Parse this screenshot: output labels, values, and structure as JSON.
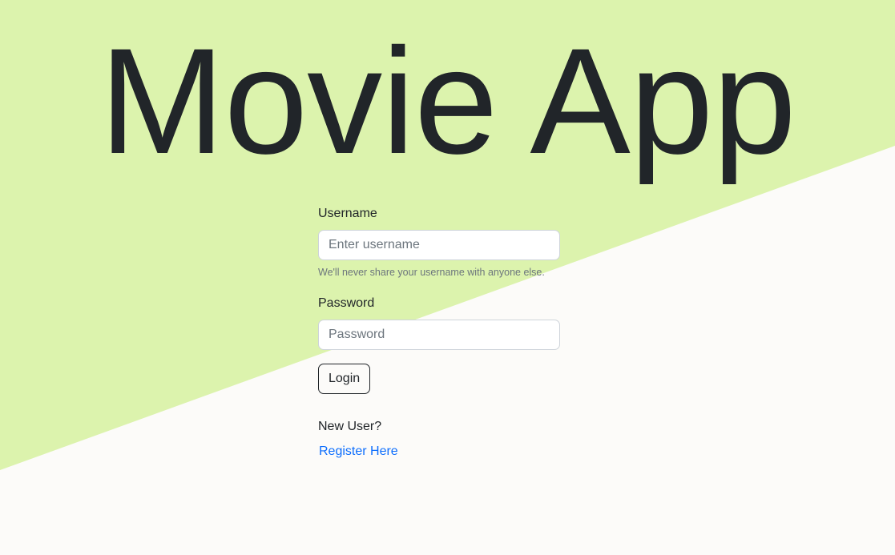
{
  "app": {
    "title": "Movie App"
  },
  "theme": {
    "background": "#fcfbf9",
    "accent_band": "#dcf3ad",
    "text": "#212529",
    "muted": "#6c757d",
    "link": "#0d6efd"
  },
  "login_form": {
    "username_label": "Username",
    "username_placeholder": "Enter username",
    "username_value": "",
    "username_help": "We'll never share your username with anyone else.",
    "password_label": "Password",
    "password_placeholder": "Password",
    "password_value": "",
    "login_label": "Login"
  },
  "register": {
    "prompt": "New User?",
    "link_label": "Register Here"
  }
}
